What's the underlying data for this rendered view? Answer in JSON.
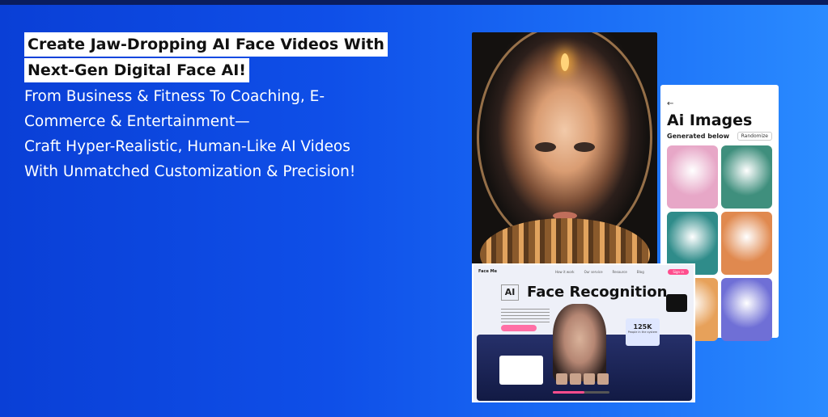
{
  "headline": {
    "line1": "Create Jaw-Dropping AI Face Videos With",
    "line2": "Next-Gen Digital Face AI!"
  },
  "body_lines": [
    "From Business & Fitness To Coaching, E-",
    "Commerce & Entertainment—",
    "Craft Hyper-Realistic, Human-Like AI Videos",
    "With Unmatched Customization & Precision!"
  ],
  "phone": {
    "back_label": "←",
    "title": "Ai Images",
    "subtitle": "Generated below",
    "randomize_label": "Randomize",
    "tiles": [
      {
        "icon": "pink-hair-girl",
        "color": "#e7a7c7"
      },
      {
        "icon": "owl",
        "color": "#3f8f7d"
      },
      {
        "icon": "teal-clouds-figure",
        "color": "#2f8c8a"
      },
      {
        "icon": "orange-hair-boy",
        "color": "#e0894f"
      },
      {
        "icon": "warm-portrait",
        "color": "#e7a15a"
      },
      {
        "icon": "blue-hair-child",
        "color": "#6f6fd6"
      }
    ]
  },
  "ui_mock": {
    "logo": "Face Me",
    "nav_items": [
      "How it work",
      "Our service",
      "Resource",
      "Blog"
    ],
    "cta_label": "Sign in",
    "ai_box": "AI",
    "title": "Face Recognition",
    "stat_number": "125K",
    "stat_label": "People in the system",
    "progress": 0.55
  },
  "colors": {
    "bg_start": "#0a3fd6",
    "bg_end": "#2a8bff",
    "accent_pink": "#ff4d8d"
  }
}
